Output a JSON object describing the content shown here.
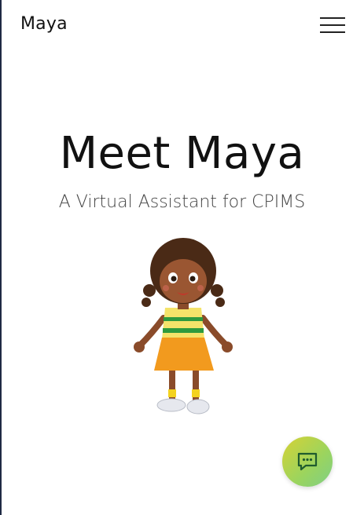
{
  "header": {
    "brand": "Maya",
    "menu_icon": "hamburger-menu-icon"
  },
  "hero": {
    "title": "Meet Maya",
    "subtitle": "A Virtual Assistant for CPIMS"
  },
  "illustration": {
    "subject": "cartoon-girl-mascot"
  },
  "chat_launcher": {
    "icon": "chat-bubble-icon",
    "colors": {
      "gradient_start": "#d6d234",
      "gradient_end": "#7fcf86",
      "icon_stroke": "#1f5c2e"
    }
  },
  "colors": {
    "background": "#ffffff",
    "text": "#111111",
    "subtitle": "#444444"
  }
}
